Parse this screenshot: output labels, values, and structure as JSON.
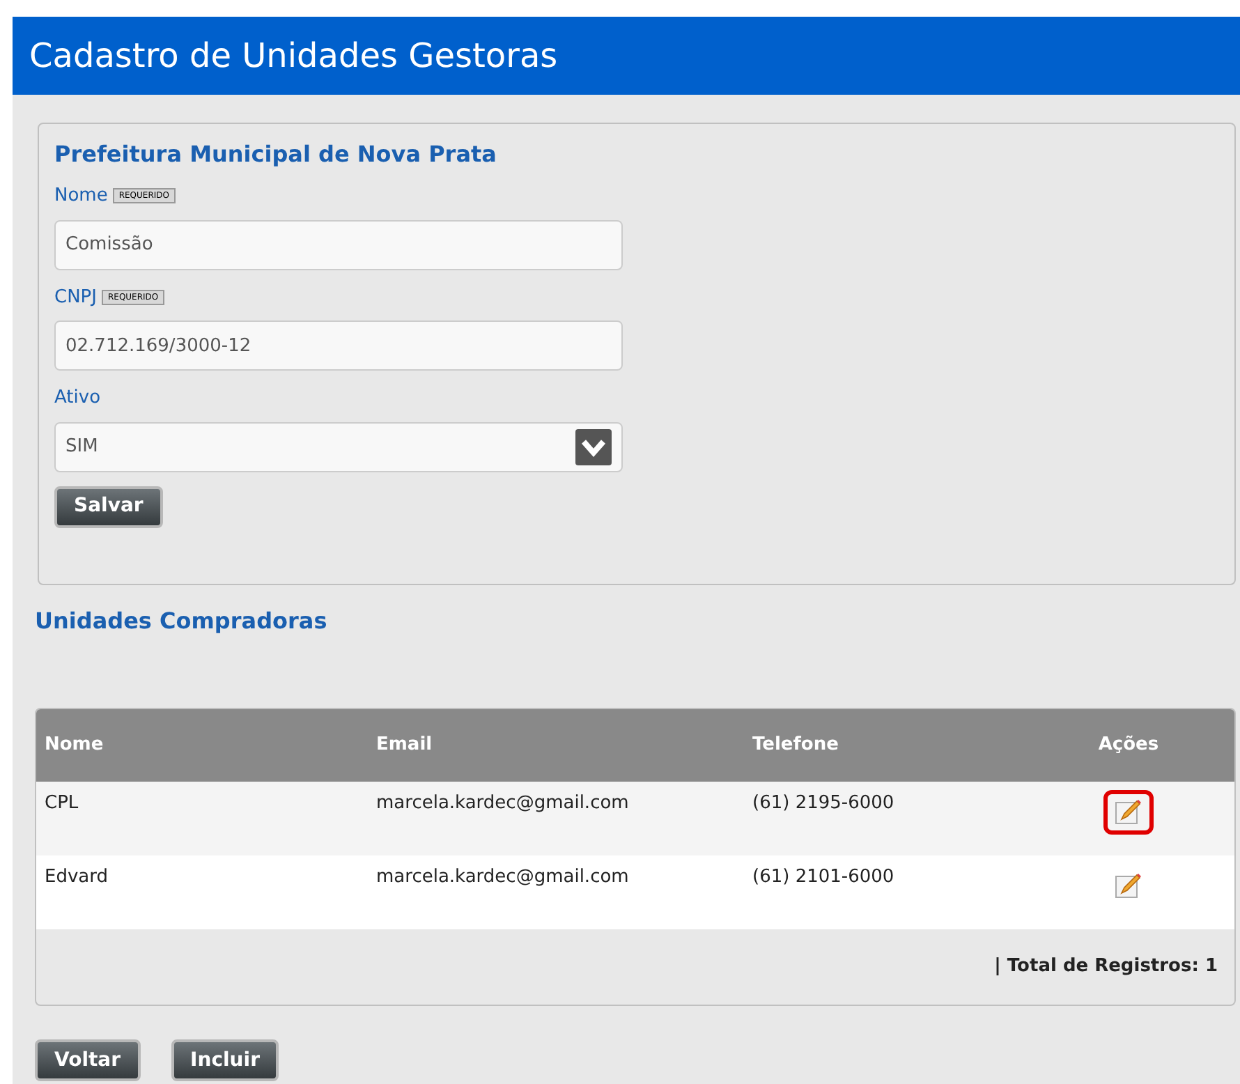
{
  "header": {
    "title": "Cadastro de Unidades Gestoras"
  },
  "form": {
    "title": "Prefeitura Municipal de Nova Prata",
    "fields": [
      {
        "kind": "text",
        "label": "Nome",
        "badge": "REQUERIDO",
        "value": "Comissão"
      },
      {
        "kind": "text",
        "label": "CNPJ",
        "badge": "REQUERIDO",
        "value": "02.712.169/3000-12"
      },
      {
        "kind": "select",
        "label": "Ativo",
        "value": "SIM"
      }
    ],
    "save_button": "Salvar"
  },
  "section_title": "Unidades Compradoras",
  "table": {
    "columns": [
      "Nome",
      "Email",
      "Telefone",
      "Ações"
    ],
    "rows": [
      {
        "cells": [
          "CPL",
          "marcela.kardec@gmail.com",
          "(61) 2195-6000"
        ],
        "highlighted": true
      },
      {
        "cells": [
          "Edvard",
          "marcela.kardec@gmail.com",
          "(61) 2101-6000"
        ],
        "highlighted": false
      }
    ],
    "footer": "| Total de Registros: 1"
  },
  "buttons": [
    "Voltar",
    "Incluir"
  ]
}
